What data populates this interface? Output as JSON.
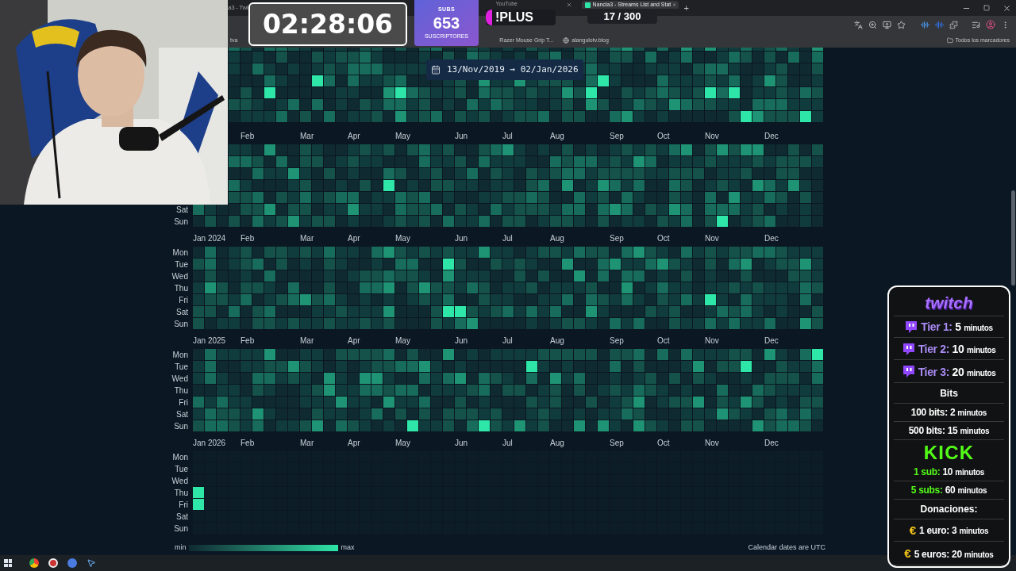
{
  "browser": {
    "tabs": [
      {
        "title": "a3 - Twi",
        "selected": false
      },
      {
        "title": "YouTube",
        "selected": false
      },
      {
        "title": "Nancla3 - Streams List and Stat",
        "selected": true
      }
    ],
    "new_tab": "+",
    "bookmarks": [
      "tva",
      "Razer Mouse Grip T...",
      "alangulotv.blog"
    ],
    "all_bookmarks": "Todos los marcadores"
  },
  "overlays": {
    "timer": "02:28:06",
    "subs": {
      "label": "SUBS",
      "count": "653",
      "caption": "SUSCRIPTORES"
    },
    "plus": "!PLUS",
    "goal": "17 / 300"
  },
  "date_range": "13/Nov/2019 → 02/Jan/2026",
  "calendar": {
    "sections": [
      {
        "kind": "clipped"
      },
      {
        "kind": "full",
        "months": [
          "Feb",
          "Mar",
          "Apr",
          "May",
          "Jun",
          "Jul",
          "Aug",
          "Sep",
          "Oct",
          "Nov",
          "Dec"
        ],
        "days": [
          "Sat",
          "Sun"
        ]
      },
      {
        "kind": "full",
        "months": [
          "Jan 2024",
          "Feb",
          "Mar",
          "Apr",
          "May",
          "Jun",
          "Jul",
          "Aug",
          "Sep",
          "Oct",
          "Nov",
          "Dec"
        ],
        "days": [
          "Mon",
          "Tue",
          "Wed",
          "Thu",
          "Fri",
          "Sat",
          "Sun"
        ]
      },
      {
        "kind": "full",
        "months": [
          "Jan 2025",
          "Feb",
          "Mar",
          "Apr",
          "May",
          "Jun",
          "Jul",
          "Aug",
          "Sep",
          "Oct",
          "Nov",
          "Dec"
        ],
        "days": [
          "Mon",
          "Tue",
          "Wed",
          "Thu",
          "Fri",
          "Sat",
          "Sun"
        ]
      },
      {
        "kind": "current",
        "months": [
          "Jan 2026",
          "Feb",
          "Mar",
          "Apr",
          "May",
          "Jun",
          "Jul",
          "Aug",
          "Sep",
          "Oct",
          "Nov",
          "Dec"
        ],
        "days": [
          "Mon",
          "Tue",
          "Wed",
          "Thu",
          "Fri",
          "Sat",
          "Sun"
        ]
      }
    ],
    "legend": {
      "min": "min",
      "max": "max"
    },
    "footnote": "Calendar dates are UTC"
  },
  "panel": {
    "title": "twitch",
    "tiers": [
      {
        "label": "Tier 1:",
        "value": "5",
        "unit": "minutos"
      },
      {
        "label": "Tier 2:",
        "value": "10",
        "unit": "minutos"
      },
      {
        "label": "Tier 3:",
        "value": "20",
        "unit": "minutos"
      }
    ],
    "bits_title": "Bits",
    "bits": [
      {
        "label": "100 bits:",
        "value": "2",
        "unit": "minutos"
      },
      {
        "label": "500 bits:",
        "value": "15",
        "unit": "minutos"
      }
    ],
    "kick_title": "KICK",
    "kick": [
      {
        "label": "1 sub:",
        "value": "10",
        "unit": "minutos"
      },
      {
        "label": "5 subs:",
        "value": "60",
        "unit": "minutos"
      }
    ],
    "donations_title": "Donaciones:",
    "donations": [
      {
        "icon": "€",
        "label": "1 euro:",
        "value": "3",
        "unit": "minutos"
      },
      {
        "icon": "€",
        "label": "5 euros:",
        "value": "20",
        "unit": "minutos"
      }
    ]
  }
}
